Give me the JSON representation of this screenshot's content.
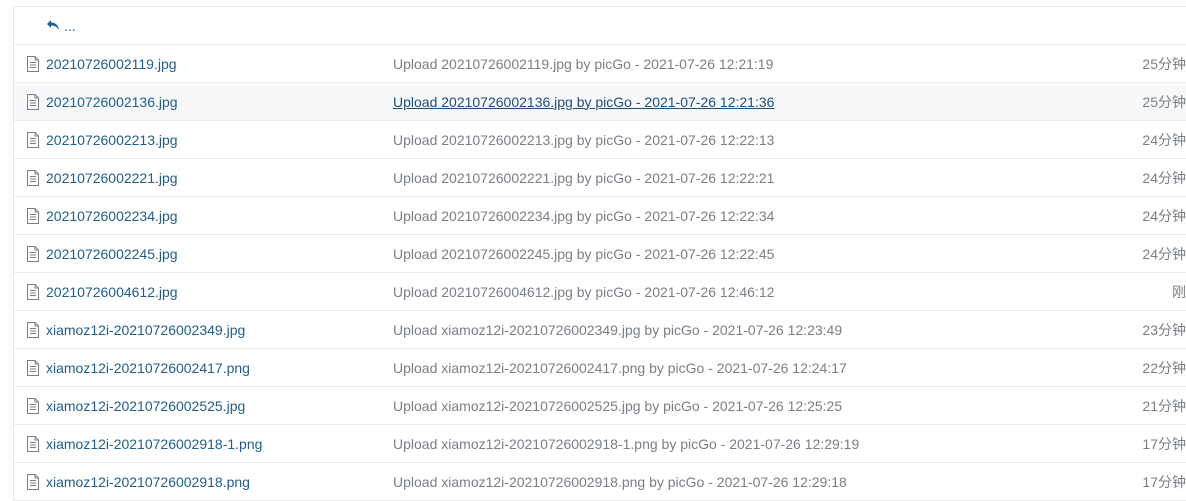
{
  "parent_row": {
    "label": "..."
  },
  "files": [
    {
      "name": "20210726002119.jpg",
      "message": "Upload 20210726002119.jpg by picGo - 2021-07-26 12:21:19",
      "age": "25分钟"
    },
    {
      "name": "20210726002136.jpg",
      "message": "Upload 20210726002136.jpg by picGo - 2021-07-26 12:21:36",
      "age": "25分钟"
    },
    {
      "name": "20210726002213.jpg",
      "message": "Upload 20210726002213.jpg by picGo - 2021-07-26 12:22:13",
      "age": "24分钟"
    },
    {
      "name": "20210726002221.jpg",
      "message": "Upload 20210726002221.jpg by picGo - 2021-07-26 12:22:21",
      "age": "24分钟"
    },
    {
      "name": "20210726002234.jpg",
      "message": "Upload 20210726002234.jpg by picGo - 2021-07-26 12:22:34",
      "age": "24分钟"
    },
    {
      "name": "20210726002245.jpg",
      "message": "Upload 20210726002245.jpg by picGo - 2021-07-26 12:22:45",
      "age": "24分钟"
    },
    {
      "name": "20210726004612.jpg",
      "message": "Upload 20210726004612.jpg by picGo - 2021-07-26 12:46:12",
      "age": "刚"
    },
    {
      "name": "xiamoz12i-20210726002349.jpg",
      "message": "Upload xiamoz12i-20210726002349.jpg by picGo - 2021-07-26 12:23:49",
      "age": "23分钟"
    },
    {
      "name": "xiamoz12i-20210726002417.png",
      "message": "Upload xiamoz12i-20210726002417.png by picGo - 2021-07-26 12:24:17",
      "age": "22分钟"
    },
    {
      "name": "xiamoz12i-20210726002525.jpg",
      "message": "Upload xiamoz12i-20210726002525.jpg by picGo - 2021-07-26 12:25:25",
      "age": "21分钟"
    },
    {
      "name": "xiamoz12i-20210726002918-1.png",
      "message": "Upload xiamoz12i-20210726002918-1.png by picGo - 2021-07-26 12:29:19",
      "age": "17分钟"
    },
    {
      "name": "xiamoz12i-20210726002918.png",
      "message": "Upload xiamoz12i-20210726002918.png by picGo - 2021-07-26 12:29:18",
      "age": "17分钟"
    }
  ],
  "hovered_row_index": 1,
  "colors": {
    "link": "#1f5e8c",
    "muted_text": "#7a7f85",
    "hover_row_bg": "#f6f8fa",
    "border": "#e9ecef"
  },
  "icons": {
    "back": "reply-arrow-icon",
    "file": "file-text-icon"
  }
}
